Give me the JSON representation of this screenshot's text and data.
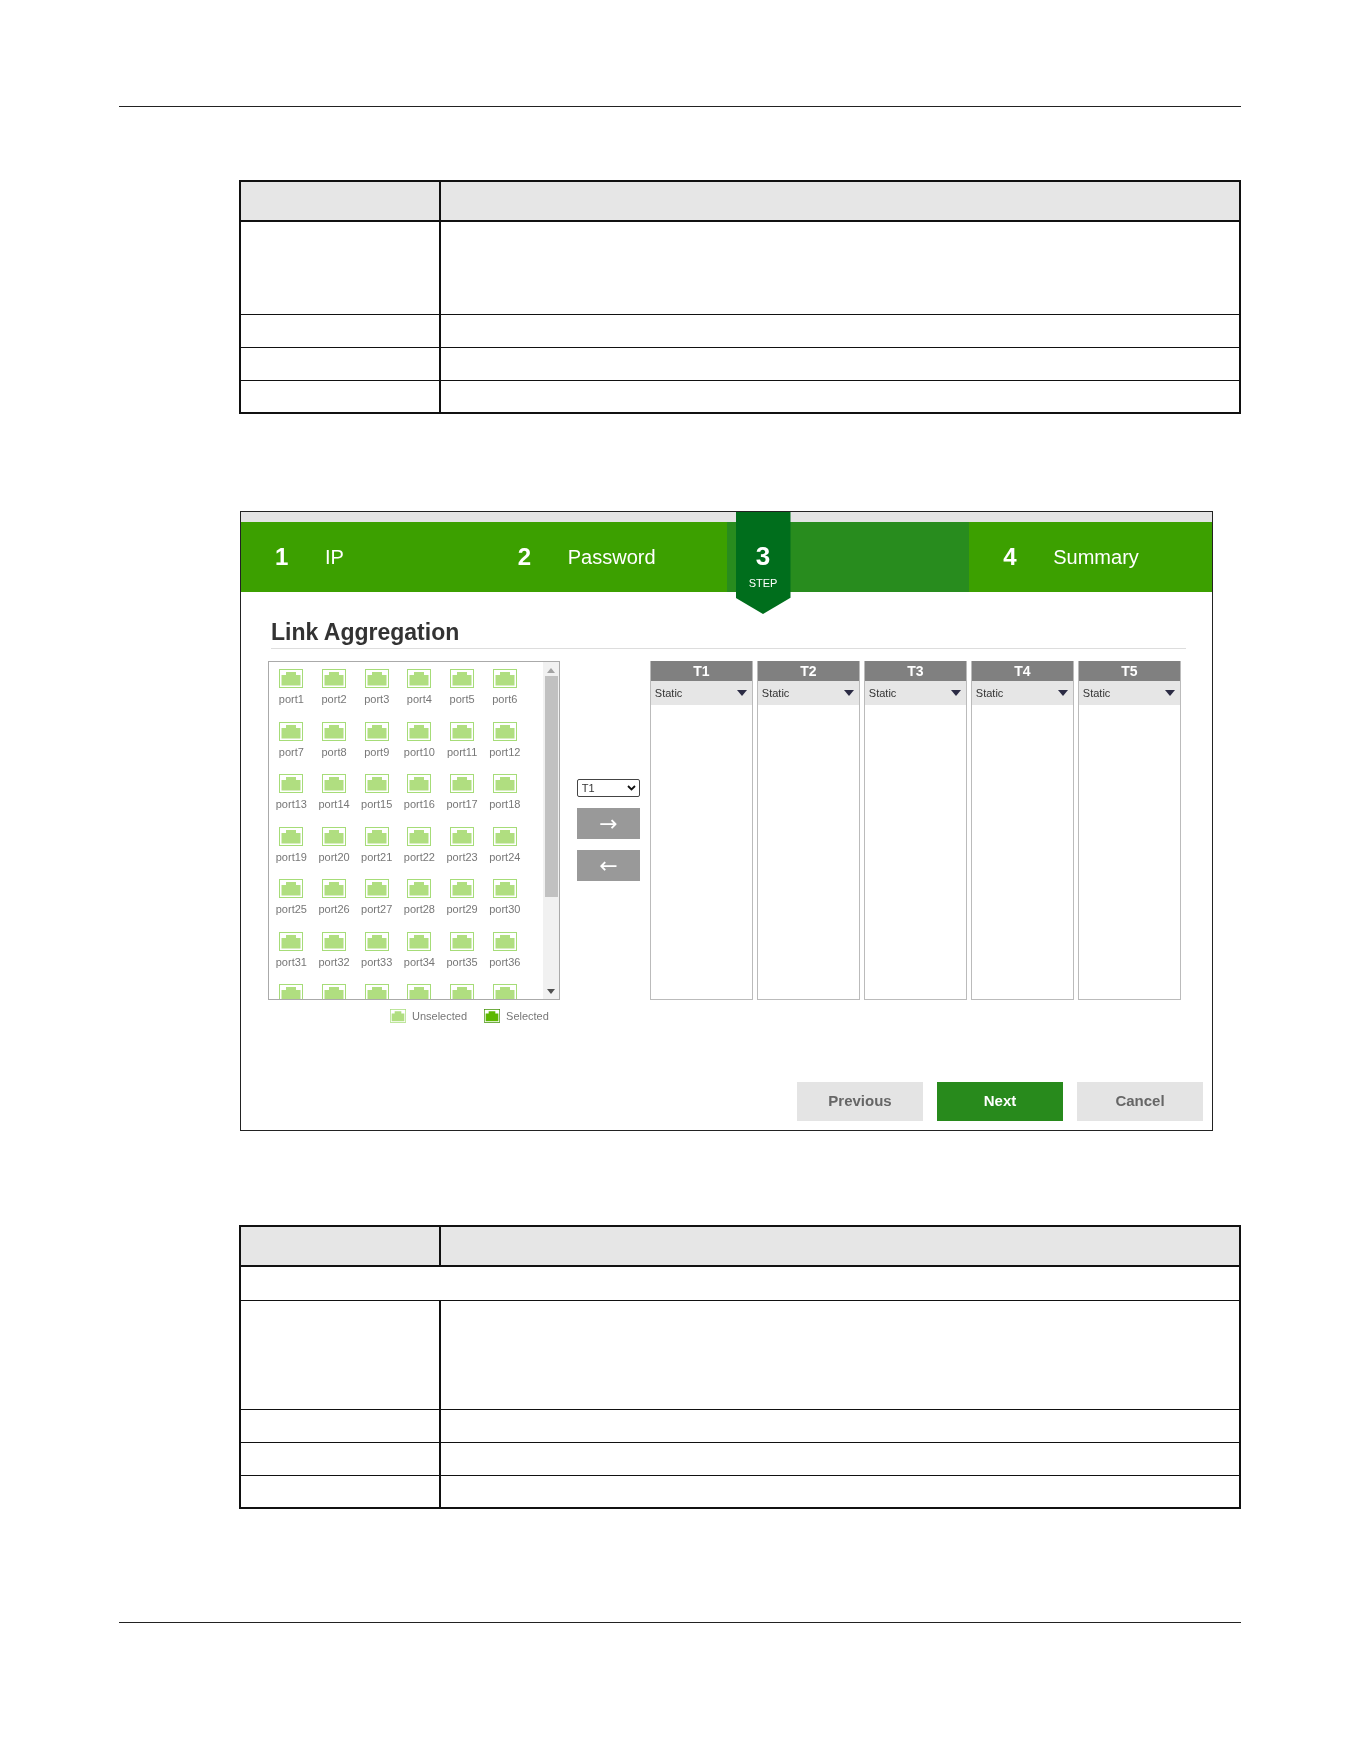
{
  "table_1": {
    "rows": [
      {
        "kind": "header"
      },
      {
        "kind": "tall"
      },
      {
        "kind": "plain"
      },
      {
        "kind": "plain"
      },
      {
        "kind": "plain"
      }
    ]
  },
  "wizard": {
    "steps": [
      {
        "number": "1",
        "label": "IP",
        "selected": false
      },
      {
        "number": "2",
        "label": "Password",
        "selected": false
      },
      {
        "number": "3",
        "caption": "STEP",
        "selected": true
      },
      {
        "number": "4",
        "label": "Summary",
        "selected": false
      }
    ],
    "title": "Link Aggregation",
    "ports": [
      {
        "label": "port1",
        "selected": false
      },
      {
        "label": "port2",
        "selected": false
      },
      {
        "label": "port3",
        "selected": false
      },
      {
        "label": "port4",
        "selected": false
      },
      {
        "label": "port5",
        "selected": false
      },
      {
        "label": "port6",
        "selected": false
      },
      {
        "label": "port7",
        "selected": false
      },
      {
        "label": "port8",
        "selected": false
      },
      {
        "label": "port9",
        "selected": false
      },
      {
        "label": "port10",
        "selected": false
      },
      {
        "label": "port11",
        "selected": false
      },
      {
        "label": "port12",
        "selected": false
      },
      {
        "label": "port13",
        "selected": false
      },
      {
        "label": "port14",
        "selected": false
      },
      {
        "label": "port15",
        "selected": false
      },
      {
        "label": "port16",
        "selected": false
      },
      {
        "label": "port17",
        "selected": false
      },
      {
        "label": "port18",
        "selected": false
      },
      {
        "label": "port19",
        "selected": false
      },
      {
        "label": "port20",
        "selected": false
      },
      {
        "label": "port21",
        "selected": false
      },
      {
        "label": "port22",
        "selected": false
      },
      {
        "label": "port23",
        "selected": false
      },
      {
        "label": "port24",
        "selected": false
      },
      {
        "label": "port25",
        "selected": false
      },
      {
        "label": "port26",
        "selected": false
      },
      {
        "label": "port27",
        "selected": false
      },
      {
        "label": "port28",
        "selected": false
      },
      {
        "label": "port29",
        "selected": false
      },
      {
        "label": "port30",
        "selected": false
      },
      {
        "label": "port31",
        "selected": false
      },
      {
        "label": "port32",
        "selected": false
      },
      {
        "label": "port33",
        "selected": false
      },
      {
        "label": "port34",
        "selected": false
      },
      {
        "label": "port35",
        "selected": false
      },
      {
        "label": "port36",
        "selected": false
      },
      {
        "selected": false
      },
      {
        "selected": false
      },
      {
        "selected": false
      },
      {
        "selected": false
      },
      {
        "selected": false
      },
      {
        "selected": false
      }
    ],
    "legend": [
      {
        "kind": "unselected",
        "label": "Unselected"
      },
      {
        "kind": "selected",
        "label": "Selected"
      }
    ],
    "trunk_select": {
      "value": "T1"
    },
    "move_buttons": [
      "→",
      "←"
    ],
    "trunks": [
      {
        "name": "T1",
        "mode": "Static"
      },
      {
        "name": "T2",
        "mode": "Static"
      },
      {
        "name": "T3",
        "mode": "Static"
      },
      {
        "name": "T4",
        "mode": "Static"
      },
      {
        "name": "T5",
        "mode": "Static"
      }
    ],
    "buttons": [
      {
        "label": "Previous",
        "kind": "secondary"
      },
      {
        "label": "Next",
        "kind": "primary"
      },
      {
        "label": "Cancel",
        "kind": "secondary"
      }
    ]
  },
  "table_2": {
    "rows": [
      {
        "kind": "header"
      },
      {
        "kind": "span"
      },
      {
        "kind": "taller"
      },
      {
        "kind": "plain"
      },
      {
        "kind": "plain"
      },
      {
        "kind": "plain"
      }
    ]
  }
}
